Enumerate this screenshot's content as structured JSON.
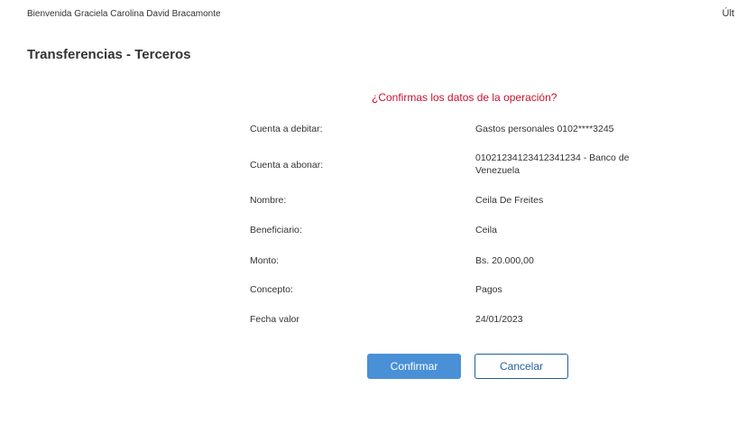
{
  "header": {
    "welcome": "Bienvenida Graciela Carolina David Bracamonte",
    "last_access": "Últ"
  },
  "page": {
    "title": "Transferencias - Terceros"
  },
  "confirmation": {
    "question": "¿Confirmas los datos de la operación?",
    "rows": [
      {
        "label": "Cuenta a debitar:",
        "value": "Gastos personales 0102****3245"
      },
      {
        "label": "Cuenta a abonar:",
        "value": "01021234123412341234 - Banco de Venezuela"
      },
      {
        "label": "Nombre:",
        "value": "Ceila De Freites"
      },
      {
        "label": "Beneficiario:",
        "value": "Ceila"
      },
      {
        "label": "Monto:",
        "value": "Bs. 20.000,00"
      },
      {
        "label": "Concepto:",
        "value": "Pagos"
      },
      {
        "label": "Fecha valor",
        "value": "24/01/2023"
      }
    ]
  },
  "actions": {
    "confirm_label": "Confirmar",
    "cancel_label": "Cancelar"
  },
  "colors": {
    "accent_question": "#c8102e",
    "primary_button": "#4a90d6",
    "secondary_border": "#1f5f9e"
  }
}
